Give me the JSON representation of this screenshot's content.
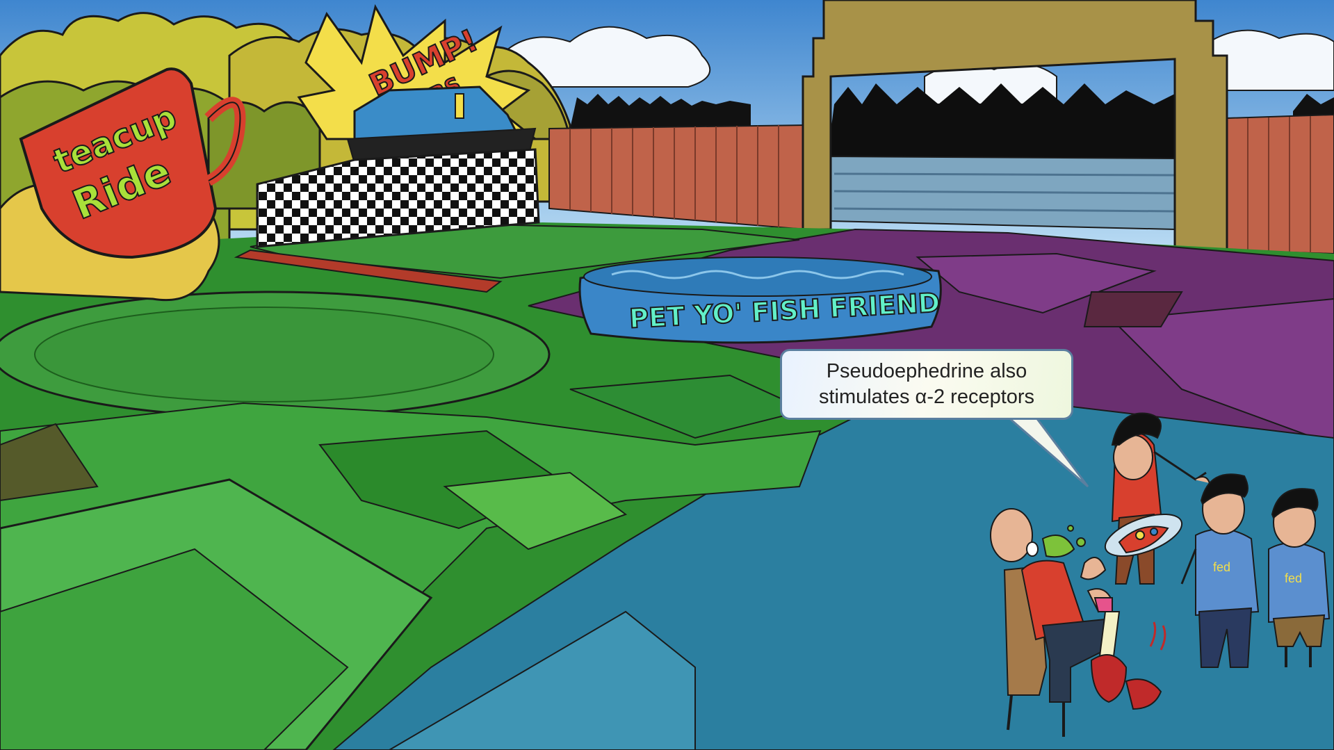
{
  "signs": {
    "teacup_line1": "teacup",
    "teacup_line2": "Ride",
    "bump_line1": "BUMP!",
    "bump_line2": "CARS",
    "pool_label": "PET YO' FISH FRIEND"
  },
  "speech_bubble": {
    "line1": "Pseudoephedrine also",
    "line2": "stimulates α-2 receptors"
  },
  "shirt_labels": {
    "left": "fed",
    "right": "fed"
  }
}
